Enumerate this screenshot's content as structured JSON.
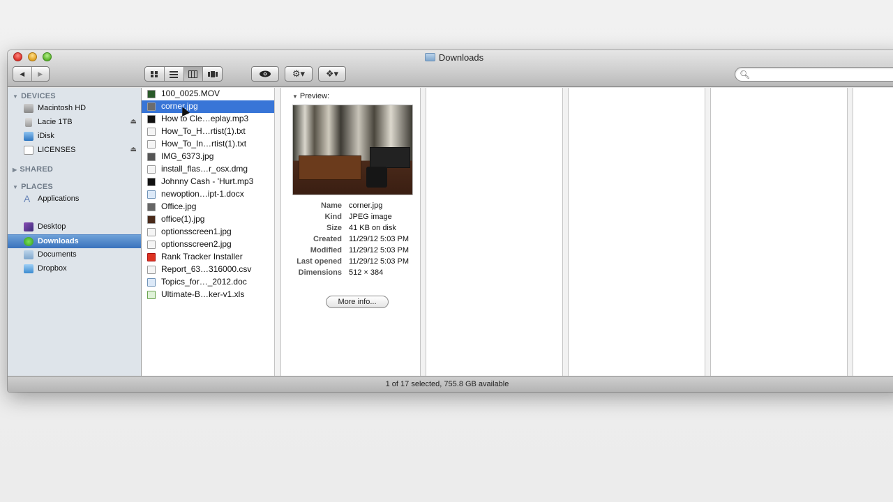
{
  "window": {
    "title": "Downloads"
  },
  "toolbar": {
    "back_glyph": "◀",
    "forward_glyph": "▶",
    "view_icons": [
      "icon-view-icon",
      "list-view-icon",
      "column-view-icon",
      "coverflow-view-icon"
    ],
    "quicklook_glyph": "👁",
    "action_glyph": "⚙▾",
    "dropbox_glyph": "❖▾",
    "search_placeholder": ""
  },
  "sidebar": {
    "devices_header": "DEVICES",
    "shared_header": "SHARED",
    "places_header": "PLACES",
    "devices": [
      {
        "label": "Macintosh HD",
        "eject": ""
      },
      {
        "label": "Lacie 1TB",
        "eject": "⏏"
      },
      {
        "label": "iDisk",
        "eject": ""
      },
      {
        "label": "LICENSES",
        "eject": "⏏"
      }
    ],
    "places": [
      {
        "label": "Applications"
      },
      {
        "label": "Desktop"
      },
      {
        "label": "Downloads"
      },
      {
        "label": "Documents"
      },
      {
        "label": "Dropbox"
      }
    ]
  },
  "files": [
    "100_0025.MOV",
    "corner.jpg",
    "How to Cle…eplay.mp3",
    "How_To_H…rtist(1).txt",
    "How_To_In…rtist(1).txt",
    "IMG_6373.jpg",
    "install_flas…r_osx.dmg",
    "Johnny Cash - 'Hurt.mp3",
    "newoption…ipt-1.docx",
    "Office.jpg",
    "office(1).jpg",
    "optionsscreen1.jpg",
    "optionsscreen2.jpg",
    "Rank Tracker Installer",
    "Report_63…316000.csv",
    "Topics_for…_2012.doc",
    "Ultimate-B…ker-v1.xls"
  ],
  "selected_file_index": 1,
  "preview": {
    "header": "Preview:",
    "rows": [
      {
        "key": "Name",
        "value": "corner.jpg"
      },
      {
        "key": "Kind",
        "value": "JPEG image"
      },
      {
        "key": "Size",
        "value": "41 KB on disk"
      },
      {
        "key": "Created",
        "value": "11/29/12 5:03 PM"
      },
      {
        "key": "Modified",
        "value": "11/29/12 5:03 PM"
      },
      {
        "key": "Last opened",
        "value": "11/29/12 5:03 PM"
      },
      {
        "key": "Dimensions",
        "value": "512 × 384"
      }
    ],
    "more_info_label": "More info..."
  },
  "status": {
    "text": "1 of 17 selected, 755.8 GB available"
  },
  "colors": {
    "selection": "#3875d7",
    "sidebar_bg": "#dee4ea"
  }
}
